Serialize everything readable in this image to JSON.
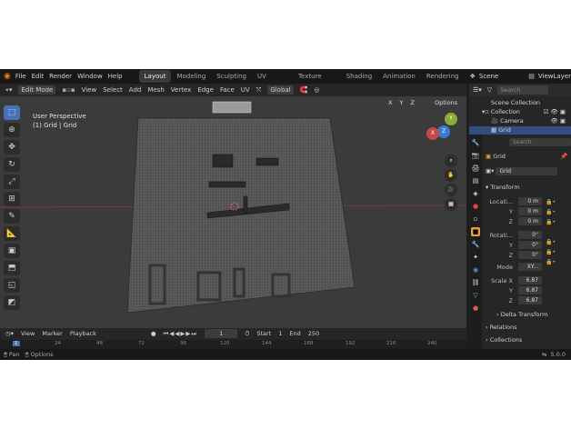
{
  "topbar": {
    "menus": [
      "File",
      "Edit",
      "Render",
      "Window",
      "Help"
    ],
    "workspaces": [
      "Layout",
      "Modeling",
      "Sculpting",
      "UV Editing",
      "Texture Paint",
      "Shading",
      "Animation",
      "Rendering"
    ],
    "active_workspace": "Layout",
    "scene": "Scene",
    "view_layer": "ViewLayer"
  },
  "viewport_header": {
    "mode": "Edit Mode",
    "menus": [
      "View",
      "Select",
      "Add",
      "Mesh",
      "Vertex",
      "Edge",
      "Face",
      "UV"
    ],
    "orientation": "Global",
    "axes": [
      "X",
      "Y",
      "Z"
    ],
    "options": "Options"
  },
  "viewport": {
    "perspective": "User Perspective",
    "object_info": "(1) Grid | Grid"
  },
  "timeline": {
    "menus": [
      "View",
      "Marker",
      "Playback"
    ],
    "current_frame": "1",
    "start_label": "Start",
    "start": "1",
    "end_label": "End",
    "end": "250",
    "ruler": [
      "24",
      "48",
      "72",
      "96",
      "120",
      "144",
      "168",
      "192",
      "216",
      "240"
    ]
  },
  "status": {
    "left": "Pan",
    "middle": "Options",
    "version": "5.0.0"
  },
  "outliner": {
    "search_placeholder": "Search",
    "items": [
      "Scene Collection",
      "Collection",
      "Camera",
      "Grid"
    ]
  },
  "properties": {
    "search_placeholder": "Search",
    "object_name": "Grid",
    "data_name": "Grid",
    "transform_label": "Transform",
    "location_label": "Locati...",
    "rotation_label": "Rotati...",
    "mode_label": "Mode",
    "mode_value": "XY...",
    "scale_label": "Scale X",
    "location": {
      "x": "0 m",
      "y": "0 m",
      "z": "0 m"
    },
    "rotation": {
      "x": "0°",
      "y": "0°",
      "z": "0°"
    },
    "scale": {
      "x": "6.87",
      "y": "6.87",
      "z": "6.87"
    },
    "axis_labels": [
      "X",
      "Y",
      "Z"
    ],
    "sections": [
      "Delta Transform",
      "Relations",
      "Collections"
    ]
  }
}
